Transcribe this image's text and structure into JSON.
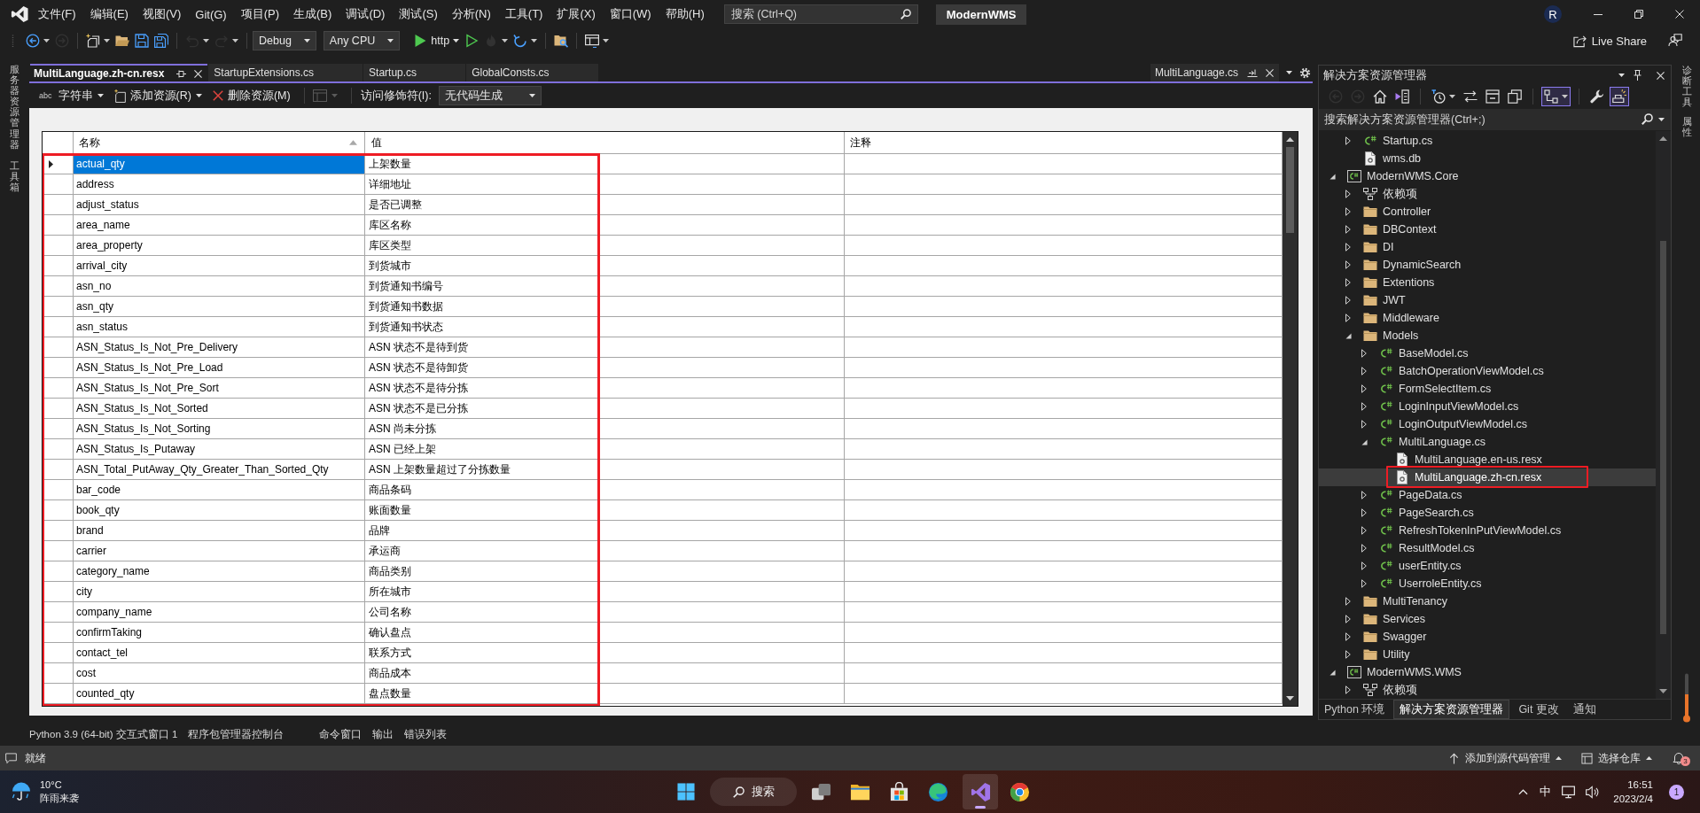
{
  "title_bar": {
    "menus": [
      "文件(F)",
      "编辑(E)",
      "视图(V)",
      "Git(G)",
      "项目(P)",
      "生成(B)",
      "调试(D)",
      "测试(S)",
      "分析(N)",
      "工具(T)",
      "扩展(X)",
      "窗口(W)",
      "帮助(H)"
    ],
    "search": {
      "placeholder": "搜索 (Ctrl+Q)"
    },
    "solution_name": "ModernWMS",
    "account_initial": "R"
  },
  "toolbar": {
    "items": [
      {
        "kind": "back",
        "disabled": false,
        "menu": true
      },
      {
        "kind": "forward",
        "disabled": true,
        "menu": false
      },
      {
        "kind": "separator"
      },
      {
        "kind": "new-item",
        "disabled": false,
        "menu": true
      },
      {
        "kind": "open",
        "disabled": false,
        "menu": false
      },
      {
        "kind": "save",
        "disabled": false,
        "menu": false
      },
      {
        "kind": "save-all",
        "disabled": false,
        "menu": false
      },
      {
        "kind": "separator"
      },
      {
        "kind": "undo",
        "disabled": true,
        "menu": true
      },
      {
        "kind": "redo",
        "disabled": true,
        "menu": true
      },
      {
        "kind": "separator"
      },
      {
        "kind": "dropdown",
        "value": "Debug"
      },
      {
        "kind": "dropdown",
        "value": "Any CPU"
      },
      {
        "kind": "run",
        "label": "http",
        "disabled": false,
        "menu": true
      },
      {
        "kind": "run-outline",
        "disabled": false,
        "menu": false
      },
      {
        "kind": "hot-reload",
        "disabled": true,
        "menu": true
      },
      {
        "kind": "restart",
        "disabled": false,
        "menu": true
      },
      {
        "kind": "separator"
      },
      {
        "kind": "find-files",
        "disabled": false,
        "menu": false
      },
      {
        "kind": "separator"
      },
      {
        "kind": "layout",
        "disabled": false,
        "menu": true
      }
    ],
    "live_share": "Live Share"
  },
  "left_side_tabs": [
    "服务器资源管理器",
    "工具箱"
  ],
  "document_tabs": [
    {
      "label": "MultiLanguage.zh-cn.resx",
      "selected": true
    },
    {
      "label": "StartupExtensions.cs",
      "selected": false
    },
    {
      "label": "Startup.cs",
      "selected": false
    },
    {
      "label": "GlobalConsts.cs",
      "selected": false
    }
  ],
  "preview_tab": {
    "label": "MultiLanguage.cs"
  },
  "resource_toolbar": {
    "type_glyph": "abc",
    "resource_type": "字符串",
    "add_resource": "添加资源(R)",
    "remove_resource": "删除资源(M)",
    "view_button": {
      "disabled": true
    },
    "access_modifier_label": "访问修饰符(I):",
    "access_modifier": "无代码生成"
  },
  "resource_table": {
    "highlighted": true,
    "columns": [
      {
        "label": "名称",
        "sorted": true
      },
      {
        "label": "值",
        "sorted": false
      },
      {
        "label": "注释",
        "sorted": false
      }
    ],
    "rows": [
      {
        "name": "actual_qty",
        "value": "上架数量",
        "selected": true
      },
      {
        "name": "address",
        "value": "详细地址",
        "selected": false
      },
      {
        "name": "adjust_status",
        "value": "是否已调整",
        "selected": false
      },
      {
        "name": "area_name",
        "value": "库区名称",
        "selected": false
      },
      {
        "name": "area_property",
        "value": "库区类型",
        "selected": false
      },
      {
        "name": "arrival_city",
        "value": "到货城市",
        "selected": false
      },
      {
        "name": "asn_no",
        "value": "到货通知书编号",
        "selected": false
      },
      {
        "name": "asn_qty",
        "value": "到货通知书数据",
        "selected": false
      },
      {
        "name": "asn_status",
        "value": "到货通知书状态",
        "selected": false
      },
      {
        "name": "ASN_Status_Is_Not_Pre_Delivery",
        "value": "ASN 状态不是待到货",
        "selected": false
      },
      {
        "name": "ASN_Status_Is_Not_Pre_Load",
        "value": "ASN 状态不是待卸货",
        "selected": false
      },
      {
        "name": "ASN_Status_Is_Not_Pre_Sort",
        "value": "ASN 状态不是待分拣",
        "selected": false
      },
      {
        "name": "ASN_Status_Is_Not_Sorted",
        "value": "ASN 状态不是已分拣",
        "selected": false
      },
      {
        "name": "ASN_Status_Is_Not_Sorting",
        "value": "ASN 尚未分拣",
        "selected": false
      },
      {
        "name": "ASN_Status_Is_Putaway",
        "value": "ASN 已经上架",
        "selected": false
      },
      {
        "name": "ASN_Total_PutAway_Qty_Greater_Than_Sorted_Qty",
        "value": "ASN 上架数量超过了分拣数量",
        "selected": false
      },
      {
        "name": "bar_code",
        "value": "商品条码",
        "selected": false
      },
      {
        "name": "book_qty",
        "value": "账面数量",
        "selected": false
      },
      {
        "name": "brand",
        "value": "品牌",
        "selected": false
      },
      {
        "name": "carrier",
        "value": "承运商",
        "selected": false
      },
      {
        "name": "category_name",
        "value": "商品类别",
        "selected": false
      },
      {
        "name": "city",
        "value": "所在城市",
        "selected": false
      },
      {
        "name": "company_name",
        "value": "公司名称",
        "selected": false
      },
      {
        "name": "confirmTaking",
        "value": "确认盘点",
        "selected": false
      },
      {
        "name": "contact_tel",
        "value": "联系方式",
        "selected": false
      },
      {
        "name": "cost",
        "value": "商品成本",
        "selected": false
      },
      {
        "name": "counted_qty",
        "value": "盘点数量",
        "selected": false
      }
    ]
  },
  "solution_explorer": {
    "title": "解决方案资源管理器",
    "toolbar": [
      {
        "kind": "back",
        "disabled": true,
        "on": false
      },
      {
        "kind": "forward",
        "disabled": true,
        "on": false
      },
      {
        "kind": "home",
        "disabled": false,
        "on": false
      },
      {
        "kind": "switch-views",
        "disabled": false,
        "on": false
      },
      {
        "kind": "separator"
      },
      {
        "kind": "history",
        "disabled": false,
        "on": false,
        "menu": true
      },
      {
        "kind": "sync",
        "disabled": false,
        "on": false
      },
      {
        "kind": "collapse-all",
        "disabled": false,
        "on": false
      },
      {
        "kind": "show-all",
        "disabled": false,
        "on": false
      },
      {
        "kind": "separator"
      },
      {
        "kind": "tree-view",
        "disabled": false,
        "on": true,
        "menu": true
      },
      {
        "kind": "separator"
      },
      {
        "kind": "properties",
        "disabled": false,
        "on": false
      },
      {
        "kind": "preview",
        "disabled": false,
        "on": true
      }
    ],
    "search": {
      "placeholder": "搜索解决方案资源管理器(Ctrl+;)"
    },
    "tree": [
      {
        "children": [
          {
            "label": "Startup.cs",
            "kind": "cs",
            "expanded": false,
            "selected": false,
            "highlighted": false
          },
          {
            "label": "wms.db",
            "kind": "file",
            "selected": false,
            "highlighted": false
          }
        ]
      },
      {
        "label": "ModernWMS.Core",
        "kind": "project",
        "expanded": true,
        "selected": false,
        "highlighted": false,
        "children": [
          {
            "label": "依赖项",
            "kind": "deps",
            "expanded": false,
            "selected": false,
            "highlighted": false
          },
          {
            "label": "Controller",
            "kind": "folder",
            "expanded": false,
            "selected": false,
            "highlighted": false
          },
          {
            "label": "DBContext",
            "kind": "folder",
            "expanded": false,
            "selected": false,
            "highlighted": false
          },
          {
            "label": "DI",
            "kind": "folder",
            "expanded": false,
            "selected": false,
            "highlighted": false
          },
          {
            "label": "DynamicSearch",
            "kind": "folder",
            "expanded": false,
            "selected": false,
            "highlighted": false
          },
          {
            "label": "Extentions",
            "kind": "folder",
            "expanded": false,
            "selected": false,
            "highlighted": false
          },
          {
            "label": "JWT",
            "kind": "folder",
            "expanded": false,
            "selected": false,
            "highlighted": false
          },
          {
            "label": "Middleware",
            "kind": "folder",
            "expanded": false,
            "selected": false,
            "highlighted": false
          },
          {
            "label": "Models",
            "kind": "folder",
            "expanded": true,
            "selected": false,
            "highlighted": false,
            "children": [
              {
                "label": "BaseModel.cs",
                "kind": "cs",
                "expanded": false,
                "selected": false,
                "highlighted": false
              },
              {
                "label": "BatchOperationViewModel.cs",
                "kind": "cs",
                "expanded": false,
                "selected": false,
                "highlighted": false
              },
              {
                "label": "FormSelectItem.cs",
                "kind": "cs",
                "expanded": false,
                "selected": false,
                "highlighted": false
              },
              {
                "label": "LoginInputViewModel.cs",
                "kind": "cs",
                "expanded": false,
                "selected": false,
                "highlighted": false
              },
              {
                "label": "LoginOutputViewModel.cs",
                "kind": "cs",
                "expanded": false,
                "selected": false,
                "highlighted": false
              },
              {
                "label": "MultiLanguage.cs",
                "kind": "cs",
                "expanded": true,
                "selected": false,
                "highlighted": false,
                "children": [
                  {
                    "label": "MultiLanguage.en-us.resx",
                    "kind": "file",
                    "selected": false,
                    "highlighted": false
                  },
                  {
                    "label": "MultiLanguage.zh-cn.resx",
                    "kind": "file",
                    "selected": true,
                    "highlighted": true
                  }
                ]
              },
              {
                "label": "PageData.cs",
                "kind": "cs",
                "expanded": false,
                "selected": false,
                "highlighted": false
              },
              {
                "label": "PageSearch.cs",
                "kind": "cs",
                "expanded": false,
                "selected": false,
                "highlighted": false
              },
              {
                "label": "RefreshTokenInPutViewModel.cs",
                "kind": "cs",
                "expanded": false,
                "selected": false,
                "highlighted": false
              },
              {
                "label": "ResultModel.cs",
                "kind": "cs",
                "expanded": false,
                "selected": false,
                "highlighted": false
              },
              {
                "label": "userEntity.cs",
                "kind": "cs",
                "expanded": false,
                "selected": false,
                "highlighted": false
              },
              {
                "label": "UserroleEntity.cs",
                "kind": "cs",
                "expanded": false,
                "selected": false,
                "highlighted": false
              }
            ]
          },
          {
            "label": "MultiTenancy",
            "kind": "folder",
            "expanded": false,
            "selected": false,
            "highlighted": false
          },
          {
            "label": "Services",
            "kind": "folder",
            "expanded": false,
            "selected": false,
            "highlighted": false
          },
          {
            "label": "Swagger",
            "kind": "folder",
            "expanded": false,
            "selected": false,
            "highlighted": false
          },
          {
            "label": "Utility",
            "kind": "folder",
            "expanded": false,
            "selected": false,
            "highlighted": false
          }
        ]
      },
      {
        "label": "ModernWMS.WMS",
        "kind": "project",
        "expanded": true,
        "selected": false,
        "highlighted": false,
        "children": [
          {
            "label": "依赖项",
            "kind": "deps",
            "expanded": false,
            "selected": false,
            "highlighted": false
          }
        ]
      }
    ],
    "tabs": [
      {
        "label": "Python 环境",
        "selected": false
      },
      {
        "label": "解决方案资源管理器",
        "selected": true
      },
      {
        "label": "Git 更改",
        "selected": false
      },
      {
        "label": "通知",
        "selected": false
      }
    ]
  },
  "right_side_tabs": [
    "诊断工具",
    "属性"
  ],
  "tool_window_tabs": [
    {
      "tabs": [
        {
          "label": "Python 3.9 (64-bit) 交互式窗口 1",
          "selected": false
        },
        {
          "label": "程序包管理器控制台",
          "selected": false
        }
      ]
    },
    {
      "tabs": [
        {
          "label": "命令窗口",
          "selected": false
        },
        {
          "label": "输出",
          "selected": false
        },
        {
          "label": "错误列表",
          "selected": false
        }
      ]
    }
  ],
  "status_bar": {
    "text": "就绪",
    "source_control": "添加到源代码管理",
    "repository": "选择仓库",
    "notification_count": "3"
  },
  "taskbar": {
    "weather": {
      "temperature": "10°C",
      "condition": "阵雨来袭"
    },
    "search": {
      "label": "搜索"
    },
    "apps": [
      {
        "kind": "task-view",
        "running": false
      },
      {
        "kind": "files",
        "running": false
      },
      {
        "kind": "store",
        "running": false
      },
      {
        "kind": "edge",
        "running": false
      },
      {
        "kind": "visual-studio",
        "running": true
      },
      {
        "kind": "chrome",
        "running": false
      }
    ],
    "input_method": "中",
    "time": "16:51",
    "date": "2023/2/4",
    "notification_count": "1"
  }
}
